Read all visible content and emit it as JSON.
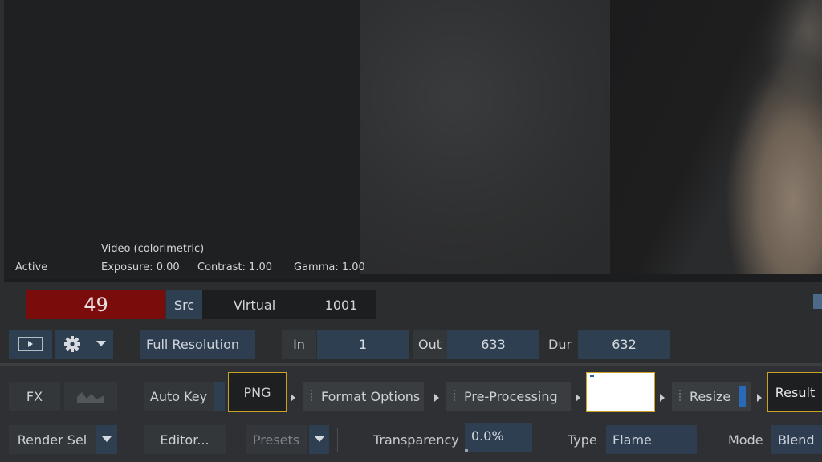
{
  "viewer": {
    "status": "Active",
    "view_mode": "Video (colorimetric)",
    "exposure": "Exposure: 0.00",
    "contrast": "Contrast: 1.00",
    "gamma": "Gamma: 1.00"
  },
  "transport": {
    "frame": "49",
    "src_label": "Src",
    "virtual_label": "Virtual",
    "virtual_value": "1001",
    "resolution": "Full Resolution",
    "in_label": "In",
    "in_value": "1",
    "out_label": "Out",
    "out_value": "633",
    "dur_label": "Dur",
    "dur_value": "632"
  },
  "panel": {
    "fx_label": "FX",
    "render_sel_label": "Render Sel",
    "auto_key_label": "Auto Key",
    "editor_label": "Editor...",
    "presets_label": "Presets",
    "nodes": {
      "png": "PNG",
      "format_options": "Format Options",
      "pre_processing": "Pre-Processing",
      "resize": "Resize",
      "result": "Result"
    },
    "transparency_label": "Transparency",
    "transparency_value": "0.0%",
    "type_label": "Type",
    "type_value": "Flame",
    "mode_label": "Mode",
    "mode_value": "Blend"
  },
  "colors": {
    "frame_bg": "#7a0c0c",
    "field_blue": "#2f3f52",
    "highlight": "#c9a227"
  },
  "icons": [
    "viewer-icon",
    "gear-icon",
    "chevron-down-icon",
    "waveform-icon",
    "arrow-right-icon",
    "grip-icon"
  ]
}
